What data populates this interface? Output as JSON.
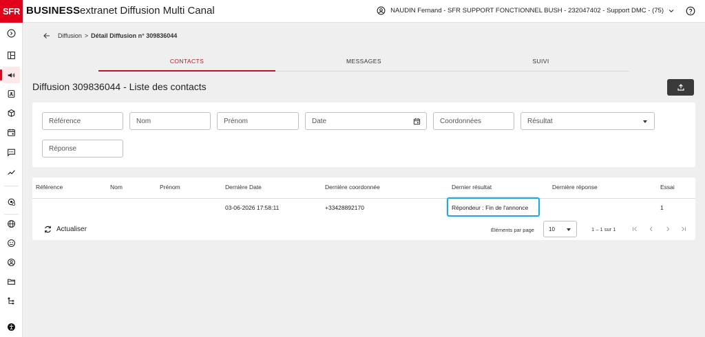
{
  "header": {
    "logo_text": "SFR",
    "brand": "BUSINESS",
    "app_title": "extranet Diffusion Multi Canal",
    "user_text": "NAUDIN Fernand - SFR SUPPORT FONCTIONNEL BUSH - 232047402 - Support DMC - (75)"
  },
  "sidebar": {
    "items": [
      "play-circle-icon",
      "dashboard-icon",
      "campaign-icon",
      "contacts-icon",
      "package-icon",
      "calendar-icon",
      "message-icon",
      "trending-icon",
      "settings-icon",
      "globe-icon",
      "emoji-icon",
      "account-icon",
      "folder-icon",
      "hierarchy-icon",
      "accessibility-icon"
    ],
    "active": "campaign-icon"
  },
  "breadcrumb": {
    "parent": "Diffusion",
    "separator": ">",
    "current": "Détail Diffusion n° 309836044"
  },
  "tabs": [
    {
      "label": "CONTACTS",
      "active": true
    },
    {
      "label": "MESSAGES",
      "active": false
    },
    {
      "label": "SUIVI",
      "active": false
    }
  ],
  "page": {
    "title": "Diffusion 309836044 - Liste des contacts"
  },
  "filters": {
    "reference": "Référence",
    "nom": "Nom",
    "prenom": "Prénom",
    "date": "Date",
    "coordonnees": "Coordonnées",
    "resultat": "Résultat",
    "reponse": "Réponse"
  },
  "table": {
    "columns": [
      "Référence",
      "Nom",
      "Prénom",
      "Dernière Date",
      "Dernière coordonnée",
      "Dernier résultat",
      "Dernière réponse",
      "Essai"
    ],
    "rows": [
      {
        "reference": "",
        "nom": "",
        "prenom": "",
        "derniere_date": "03-06-2026 17:58:11",
        "derniere_coordonnee": "+33428892170",
        "dernier_resultat": "Répondeur : Fin de l'annonce",
        "derniere_reponse": "",
        "essai": "1"
      }
    ]
  },
  "footer": {
    "refresh_label": "Actualiser",
    "per_page_label": "Éléments par page",
    "per_page_value": "10",
    "range": "1 – 1 sur 1"
  },
  "colors": {
    "brand_red": "#e2001a",
    "tab_active": "#c0111f",
    "highlight": "#26a5dd"
  }
}
